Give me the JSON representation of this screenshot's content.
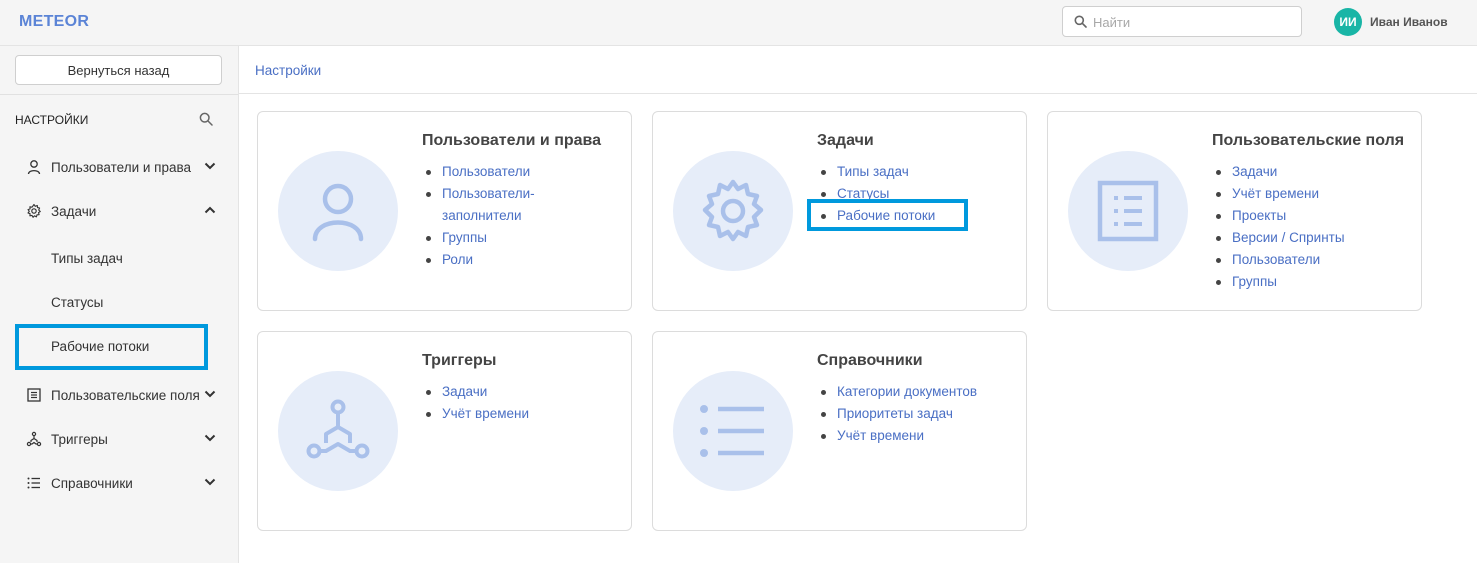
{
  "header": {
    "logo": "METEOR",
    "search_placeholder": "Найти",
    "user_initials": "ИИ",
    "user_name": "Иван Иванов"
  },
  "sidebar": {
    "back_button": "Вернуться назад",
    "section_title": "НАСТРОЙКИ",
    "items": [
      {
        "label": "Пользователи и права",
        "icon": "user-icon",
        "expanded": false
      },
      {
        "label": "Задачи",
        "icon": "gear-icon",
        "expanded": true,
        "children": [
          "Типы задач",
          "Статусы",
          "Рабочие потоки"
        ]
      },
      {
        "label": "Пользовательские поля",
        "icon": "form-icon",
        "expanded": false
      },
      {
        "label": "Триггеры",
        "icon": "trigger-icon",
        "expanded": false
      },
      {
        "label": "Справочники",
        "icon": "list-icon",
        "expanded": false
      }
    ],
    "highlighted_item": "Рабочие потоки"
  },
  "breadcrumb": "Настройки",
  "cards": [
    {
      "title": "Пользователи и права",
      "icon": "user-icon",
      "links": [
        "Пользователи",
        "Пользователи-",
        "заполнители",
        "Группы",
        "Роли"
      ]
    },
    {
      "title": "Задачи",
      "icon": "gear-icon",
      "links": [
        "Типы задач",
        "Статусы",
        "Рабочие потоки"
      ]
    },
    {
      "title": "Пользовательские поля",
      "icon": "form-icon",
      "links": [
        "Задачи",
        "Учёт времени",
        "Проекты",
        "Версии / Спринты",
        "Пользователи",
        "Группы"
      ]
    },
    {
      "title": "Триггеры",
      "icon": "trigger-icon",
      "links": [
        "Задачи",
        "Учёт времени"
      ]
    },
    {
      "title": "Справочники",
      "icon": "list-icon",
      "links": [
        "Категории документов",
        "Приоритеты задач",
        "Учёт времени"
      ]
    }
  ],
  "colors": {
    "accent": "#5b84d6",
    "link": "#4a6fc4",
    "highlight": "#0099dd",
    "avatar": "#19b5a6",
    "icon_bg": "#e6edf9",
    "icon_fg": "#a9c0ea"
  }
}
